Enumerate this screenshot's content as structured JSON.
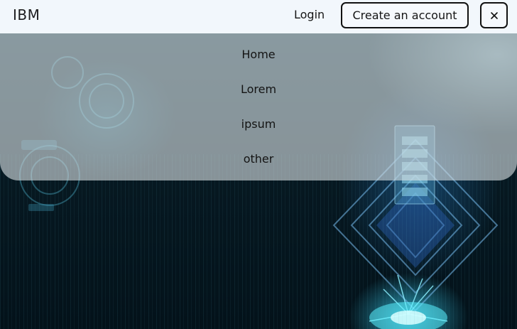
{
  "header": {
    "brand": "IBM",
    "login_label": "Login",
    "create_account_label": "Create an account",
    "close_icon": "close-icon"
  },
  "menu": {
    "items": [
      {
        "label": "Home"
      },
      {
        "label": "Lorem"
      },
      {
        "label": "ipsum"
      },
      {
        "label": "other"
      }
    ]
  },
  "colors": {
    "header_bg": "#f2f7fc",
    "menu_overlay": "#d6dee2",
    "hero_dark": "#06131b",
    "hero_glow": "#3cdcff"
  }
}
